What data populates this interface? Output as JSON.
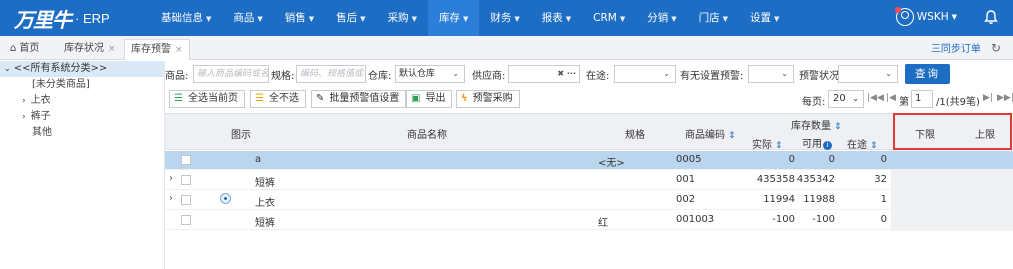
{
  "app": {
    "logo_mark": "万里牛",
    "logo_suffix": "· ERP"
  },
  "nav": {
    "items": [
      {
        "label": "基础信息"
      },
      {
        "label": "商品"
      },
      {
        "label": "销售"
      },
      {
        "label": "售后"
      },
      {
        "label": "采购"
      },
      {
        "label": "库存"
      },
      {
        "label": "财务"
      },
      {
        "label": "报表"
      },
      {
        "label": "CRM"
      },
      {
        "label": "分销"
      },
      {
        "label": "门店"
      },
      {
        "label": "设置"
      }
    ],
    "active": "库存",
    "user": "WSKH"
  },
  "tabs": {
    "home": "首页",
    "stock_status": "库存状况",
    "stock_alert": "库存预警",
    "close": "×"
  },
  "sync_order": "三同步订单",
  "sidebar": {
    "root": "<<所有系统分类>>",
    "items": [
      "[未分类商品]",
      "上衣",
      "裤子",
      "其他"
    ]
  },
  "filters": {
    "product_label": "商品:",
    "product_placeholder": "输入商品编码或名称",
    "spec_label": "规格:",
    "spec_placeholder": "编码、规格值或名称",
    "warehouse_label": "仓库:",
    "warehouse_value": "默认仓库",
    "supplier_label": "供应商:",
    "in_transit_label": "在途:",
    "has_alert_label": "有无设置预警:",
    "alert_status_label": "预警状况:",
    "query_button": "查询"
  },
  "toolbar": {
    "select_page": "全选当前页",
    "deselect_all": "全不选",
    "batch_alert": "批量预警值设置",
    "export": "导出",
    "alert_purchase": "预警采购",
    "per_page_label": "每页:",
    "per_page": "20",
    "page_label": "第",
    "page": "1",
    "page_total": "/1(共9笔)"
  },
  "grid": {
    "headers": {
      "picture": "图示",
      "name": "商品名称",
      "spec": "规格",
      "code": "商品编码",
      "stock_qty": "库存数量",
      "actual": "实际",
      "available": "可用",
      "in_transit": "在途",
      "lower": "下限",
      "upper": "上限"
    },
    "rows": [
      {
        "name": "a",
        "spec": "<无>",
        "code": "0005",
        "actual": "0",
        "available": "0",
        "in_transit": "0"
      },
      {
        "name": "短裤",
        "spec": "",
        "code": "001",
        "actual": "435358",
        "available": "435342",
        "in_transit": "32"
      },
      {
        "name": "上衣",
        "spec": "",
        "code": "002",
        "actual": "11994",
        "available": "11988",
        "in_transit": "1"
      },
      {
        "name": "短裤",
        "spec": "红",
        "code": "001003",
        "actual": "-100",
        "available": "-100",
        "in_transit": "0"
      }
    ]
  },
  "colors": {
    "nav_bg": "#1e6dc4",
    "selected_row": "#bad6ee",
    "highlight_border": "#e53935"
  }
}
